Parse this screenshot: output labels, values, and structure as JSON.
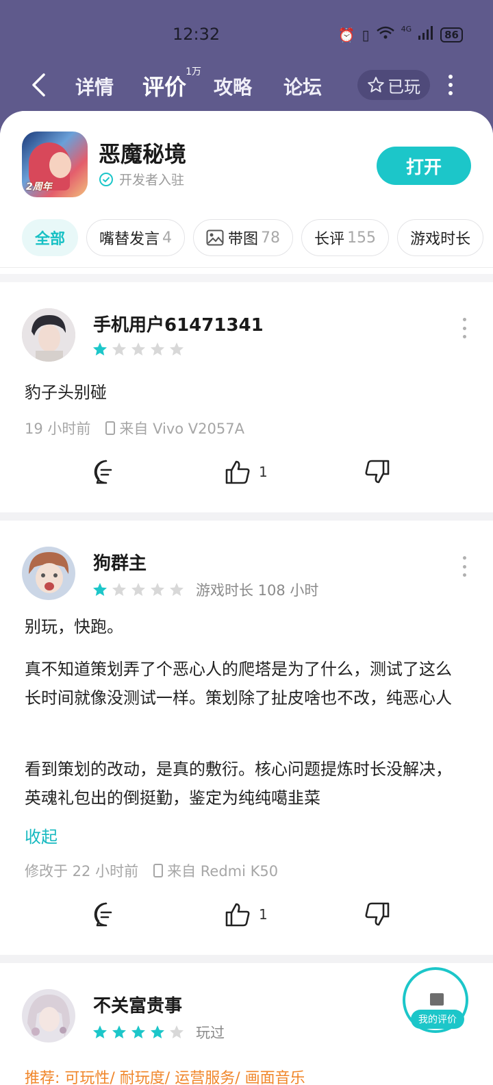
{
  "status_bar": {
    "time": "12:32",
    "network": "4G",
    "battery": "86"
  },
  "nav": {
    "tabs": [
      {
        "label": "详情"
      },
      {
        "label": "评价",
        "badge": "1万"
      },
      {
        "label": "攻略"
      },
      {
        "label": "论坛"
      }
    ],
    "played_label": "已玩"
  },
  "app": {
    "name": "恶魔秘境",
    "verified_text": "开发者入驻",
    "open_label": "打开",
    "icon_text": "2周年"
  },
  "filters": [
    {
      "label": "全部",
      "count": ""
    },
    {
      "label": "嘴替发言",
      "count": "4"
    },
    {
      "label": "带图",
      "count": "78"
    },
    {
      "label": "长评",
      "count": "155"
    },
    {
      "label": "游戏时长",
      "count": ""
    }
  ],
  "reviews": [
    {
      "username": "手机用户61471341",
      "rating": 1,
      "play_time": "",
      "paragraphs": [
        "豹子头别碰"
      ],
      "time": "19 小时前",
      "device": "来自 Vivo V2057A",
      "likes": "1"
    },
    {
      "username": "狗群主",
      "rating": 1,
      "play_time": "游戏时长 108 小时",
      "paragraphs": [
        "别玩，快跑。",
        "真不知道策划弄了个恶心人的爬塔是为了什么，测试了这么长时间就像没测试一样。策划除了扯皮啥也不改，纯恶心人",
        "看到策划的改动，是真的敷衍。核心问题提炼时长没解决，英魂礼包出的倒挺勤，鉴定为纯纯噶韭菜"
      ],
      "collapse_label": "收起",
      "time": "修改于 22 小时前",
      "device": "来自 Redmi K50",
      "likes": "1"
    },
    {
      "username": "不关富贵事",
      "rating": 4,
      "play_time": "玩过",
      "recommend": "推荐: 可玩性/ 耐玩度/ 运营服务/ 画面音乐"
    }
  ],
  "fab": {
    "label": "我的评价"
  },
  "colors": {
    "brand": "#1cc6c9",
    "header_bg": "#5f5a8c",
    "star_on": "#1cc6c9",
    "star_off": "#d8d8d8"
  }
}
